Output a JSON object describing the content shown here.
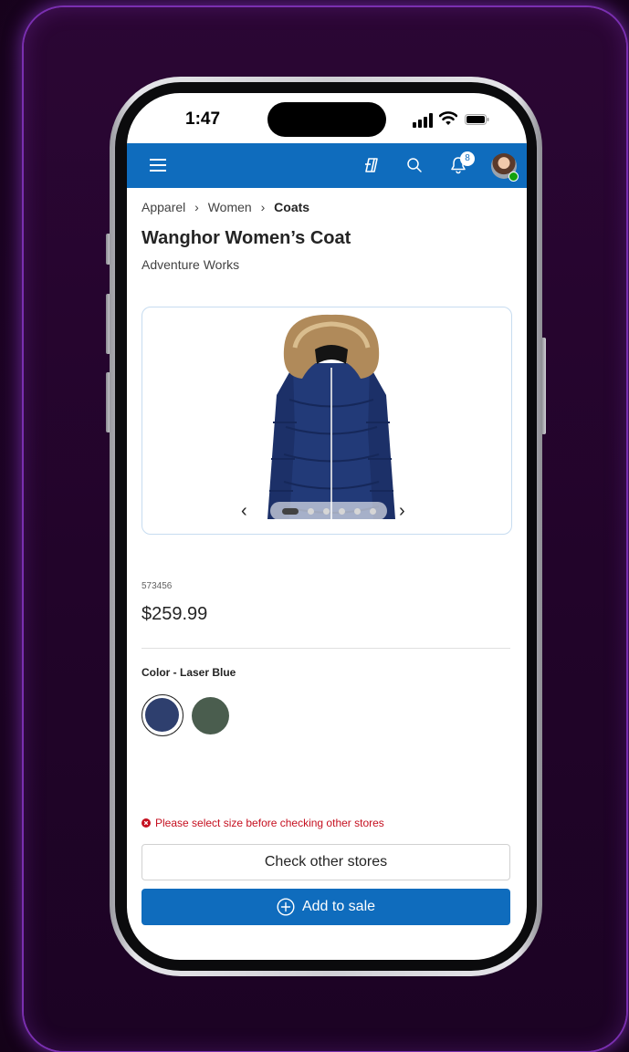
{
  "status_bar": {
    "time": "1:47",
    "icons": [
      "cellular-signal-icon",
      "wifi-icon",
      "battery-icon"
    ]
  },
  "app_bar": {
    "brand_color": "#0f6cbd",
    "icons": [
      "menu-icon",
      "copilot-icon",
      "search-icon",
      "notification-bell-icon"
    ],
    "notification_count": "8",
    "presence_color": "#13a10e"
  },
  "breadcrumb": {
    "items": [
      "Apparel",
      "Women",
      "Coats"
    ]
  },
  "product": {
    "title": "Wanghor Women’s Coat",
    "brand": "Adventure Works",
    "sku": "573456",
    "price": "$259.99",
    "image_count": 6,
    "active_image": 1
  },
  "color": {
    "label": "Color - Laser Blue",
    "swatches": [
      {
        "name": "Laser Blue",
        "hex": "#2e3f6e",
        "selected": true
      },
      {
        "name": "Green",
        "hex": "#4a5d4e",
        "selected": false
      }
    ]
  },
  "validation": {
    "message": "Please select size before checking other stores",
    "color": "#c50f1f"
  },
  "actions": {
    "check_stores": "Check other stores",
    "add_to_sale": "Add to sale"
  }
}
